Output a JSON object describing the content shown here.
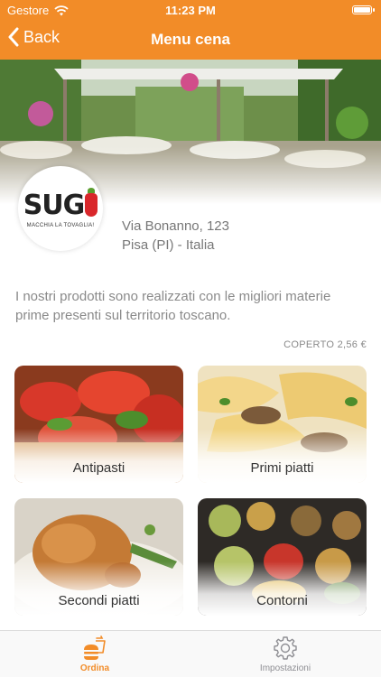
{
  "status_bar": {
    "carrier": "Gestore",
    "time": "11:23 PM"
  },
  "nav": {
    "back_label": "Back",
    "title": "Menu cena"
  },
  "restaurant": {
    "logo_text": "SUG",
    "logo_tagline": "MACCHIA LA TOVAGLIA!",
    "address_line1": "Via Bonanno, 123",
    "address_line2": "Pisa (PI) - Italia",
    "description": "I nostri prodotti sono realizzati con le migliori materie prime presenti sul territorio toscano.",
    "coperto": "COPERTO 2,56 €"
  },
  "categories": [
    {
      "label": "Antipasti",
      "icon": "tomato-bruschetta-image"
    },
    {
      "label": "Primi piatti",
      "icon": "pasta-image"
    },
    {
      "label": "Secondi piatti",
      "icon": "roast-chicken-image"
    },
    {
      "label": "Contorni",
      "icon": "grilled-vegetables-image"
    }
  ],
  "tabbar": {
    "items": [
      {
        "label": "Ordina",
        "icon": "burger-drink-icon",
        "active": true
      },
      {
        "label": "Impostazioni",
        "icon": "gear-icon",
        "active": false
      }
    ]
  },
  "colors": {
    "accent": "#f28c28",
    "inactive_tab": "#8e8e93",
    "logo_red": "#d9272b"
  }
}
